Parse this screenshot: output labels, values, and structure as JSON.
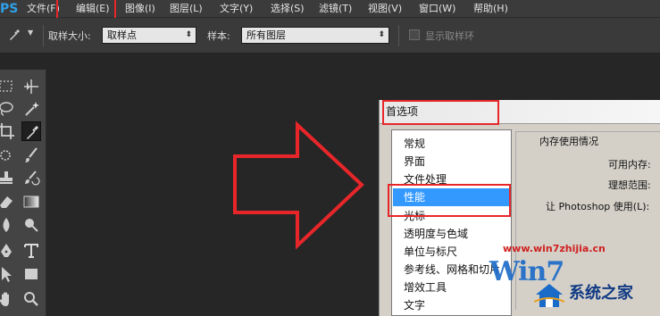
{
  "app": {
    "logo": "PS"
  },
  "menu": {
    "items": [
      "文件(F)",
      "编辑(E)",
      "图像(I)",
      "图层(L)",
      "文字(Y)",
      "选择(S)",
      "滤镜(T)",
      "视图(V)",
      "窗口(W)",
      "帮助(H)"
    ]
  },
  "options": {
    "sample_size_label": "取样大小:",
    "sample_size_value": "取样点",
    "sample_label": "样本:",
    "sample_value": "所有图层",
    "show_ring_label": "显示取样环"
  },
  "dialog": {
    "title": "首选项",
    "categories": [
      "常规",
      "界面",
      "文件处理",
      "性能",
      "光标",
      "透明度与色域",
      "单位与标尺",
      "参考线、网格和切片",
      "增效工具",
      "文字"
    ],
    "selected_category": "性能",
    "memory_group_title": "内存使用情况",
    "available_memory_label": "可用内存:",
    "ideal_range_label": "理想范围:",
    "let_photoshop_use_label": "让 Photoshop 使用(L):"
  },
  "watermark": {
    "url": "www.win7zhijia.cn",
    "logo_text": "Win7",
    "site_name": "系统之家"
  },
  "colors": {
    "highlight": "#e8262a",
    "selection": "#3399ff",
    "ps_logo": "#2fa0e8"
  }
}
